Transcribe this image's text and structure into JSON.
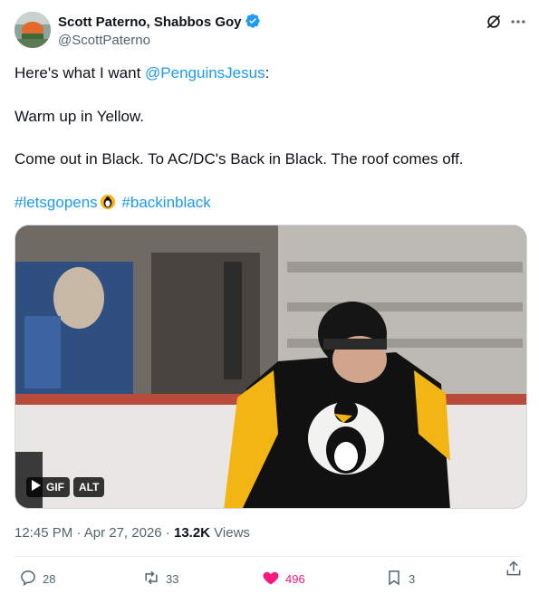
{
  "author": {
    "name": "Scott Paterno, Shabbos Goy",
    "handle": "@ScottPaterno"
  },
  "tweet": {
    "line1_prefix": "Here's what I want ",
    "line1_mention": "@PenguinsJesus",
    "line1_suffix": ":",
    "line2": "Warm up in Yellow.",
    "line3": "Come out in Black.  To AC/DC's Back in Black.  The roof comes off.",
    "hashtag1": "#letsgopens",
    "hashtag2": "#backinblack"
  },
  "media": {
    "gif_label": "GIF",
    "alt_label": "ALT"
  },
  "meta": {
    "time": "12:45 PM",
    "sep1": " · ",
    "date": "Apr 27, 2026",
    "sep2": " · ",
    "views_count": "13.2K",
    "views_label": " Views"
  },
  "actions": {
    "replies": "28",
    "reposts": "33",
    "likes": "496",
    "bookmarks": "3"
  },
  "colors": {
    "link": "#1d9bf0",
    "like": "#f91880",
    "secondary_text": "#536471"
  }
}
